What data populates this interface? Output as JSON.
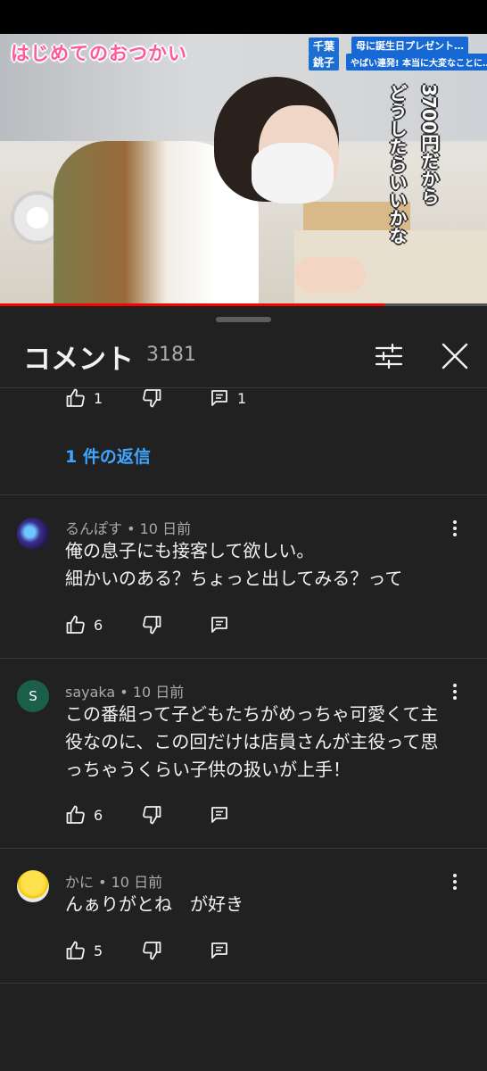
{
  "video": {
    "logo": "はじめてのおつかい",
    "location_1": "千葉",
    "location_2": "銚子",
    "telop_1": "母に誕生日プレゼント…",
    "telop_2": "やばい連発! 本当に大変なことに…",
    "caption_col1": "3700円だから",
    "caption_col2": "どうしたらいいかな",
    "progress": 0.79
  },
  "sheet": {
    "title": "コメント",
    "count": "3181",
    "filter_icon": "sliders-icon",
    "close_icon": "close-icon"
  },
  "top_partial": {
    "likes": "1",
    "replies": "1",
    "reply_link": "1 件の返信"
  },
  "comments": [
    {
      "author": "るんぽす",
      "time": "10 日前",
      "text_lines": [
        "俺の息子にも接客して欲しい。",
        "細かいのある？ちょっと出してみる？って"
      ],
      "likes": "6"
    },
    {
      "author": "sayaka",
      "avatar_letter": "S",
      "avatar_color": "#1b5e4a",
      "time": "10 日前",
      "text_lines": [
        "この番組って子どもたちがめっちゃ可愛くて主",
        "役なのに、この回だけは店員さんが主役って思",
        "っちゃうくらい子供の扱いが上手！"
      ],
      "likes": "6"
    },
    {
      "author": "かに",
      "time": "10 日前",
      "text_lines": [
        "んぁりがとね　が好き"
      ],
      "likes": "5"
    }
  ],
  "colors": {
    "background": "#212121",
    "link": "#3ea6ff",
    "secondary_text": "#aaaaaa",
    "progress": "#ff0000"
  }
}
